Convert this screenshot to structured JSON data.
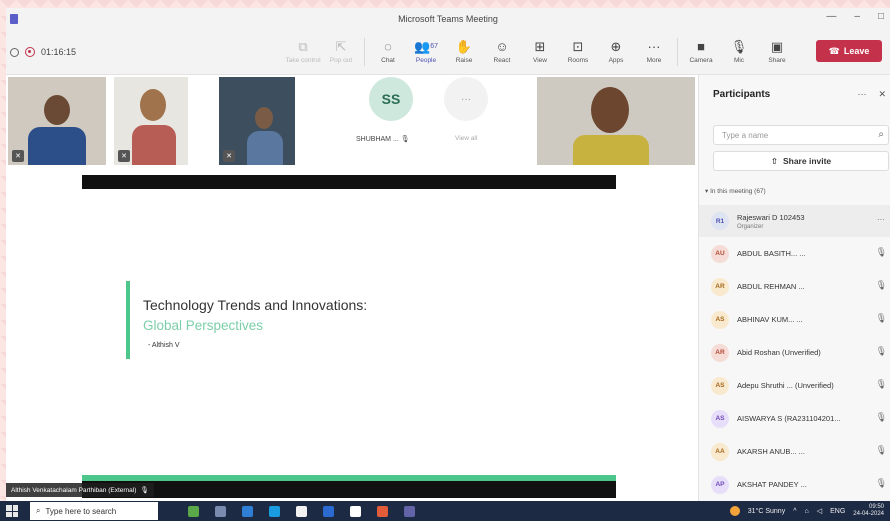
{
  "window": {
    "title": "Microsoft Teams Meeting",
    "controls": [
      "—",
      "–",
      "□"
    ]
  },
  "toolbar": {
    "timer": "01:16:15",
    "buttons": [
      {
        "label": "Take control",
        "icon": "take-control-icon",
        "glyph": "⧉",
        "disabled": true
      },
      {
        "label": "Pop out",
        "icon": "pop-out-icon",
        "glyph": "⇱",
        "disabled": true
      },
      {
        "label": "Chat",
        "icon": "chat-icon",
        "glyph": "◌"
      },
      {
        "label": "People",
        "icon": "people-icon",
        "glyph": "👥",
        "active": true,
        "count": "67"
      },
      {
        "label": "Raise",
        "icon": "raise-hand-icon",
        "glyph": "✋"
      },
      {
        "label": "React",
        "icon": "react-icon",
        "glyph": "☺"
      },
      {
        "label": "View",
        "icon": "view-icon",
        "glyph": "⊞"
      },
      {
        "label": "Rooms",
        "icon": "rooms-icon",
        "glyph": "⊡"
      },
      {
        "label": "Apps",
        "icon": "apps-icon",
        "glyph": "⊕"
      },
      {
        "label": "More",
        "icon": "more-icon",
        "glyph": "···"
      }
    ],
    "device_buttons": [
      {
        "label": "Camera",
        "icon": "camera-icon",
        "glyph": "■"
      },
      {
        "label": "Mic",
        "icon": "mic-icon",
        "glyph": "🎙"
      },
      {
        "label": "Share",
        "icon": "share-icon",
        "glyph": "▣"
      }
    ],
    "leave_label": "Leave"
  },
  "stage": {
    "avatar_initials": "SS",
    "avatar_name": "SHUBHAM ...",
    "view_all_label": "View all",
    "presenter": "Althish Venkatachalam Parthiban (External)"
  },
  "slide": {
    "title": "Technology Trends and Innovations:",
    "subtitle": "Global Perspectives",
    "author": "- Althish V",
    "accent": "#4cc68a"
  },
  "panel": {
    "title": "Participants",
    "search_placeholder": "Type a name",
    "share_label": "Share invite",
    "section_label": "In this meeting (67)",
    "participants": [
      {
        "initials": "R1",
        "name": "Rajeswari D 102453",
        "role": "Organizer"
      },
      {
        "initials": "AU",
        "name": "ABDUL BASITH... ..."
      },
      {
        "initials": "AR",
        "name": "ABDUL REHMAN ..."
      },
      {
        "initials": "AS",
        "name": "ABHINAV KUM... ..."
      },
      {
        "initials": "AR",
        "name": "Abid Roshan (Unverified)"
      },
      {
        "initials": "AS",
        "name": "Adepu Shruthi ... (Unverified)"
      },
      {
        "initials": "AS",
        "name": "AISWARYA S (RA231104201..."
      },
      {
        "initials": "AA",
        "name": "AKARSH ANUB... ..."
      },
      {
        "initials": "AP",
        "name": "AKSHAT PANDEY ..."
      }
    ]
  },
  "taskbar": {
    "search_placeholder": "Type here to search",
    "weather": "31°C Sunny",
    "lang": "ENG",
    "time": "09:50",
    "date": "24-04-2024"
  }
}
